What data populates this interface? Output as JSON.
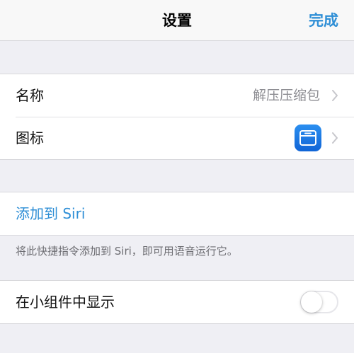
{
  "nav": {
    "title": "设置",
    "done_label": "完成"
  },
  "details": {
    "name_label": "名称",
    "name_value": "解压压缩包",
    "icon_label": "图标",
    "icon_name": "archive-box-icon",
    "icon_color": "#1f7ae6"
  },
  "siri": {
    "add_label": "添加到 Siri",
    "footnote": "将此快捷指令添加到 Siri，即可用语音运行它。"
  },
  "widget": {
    "label": "在小组件中显示",
    "enabled": false
  },
  "colors": {
    "accent": "#2f8fd6",
    "background": "#efeff4"
  }
}
